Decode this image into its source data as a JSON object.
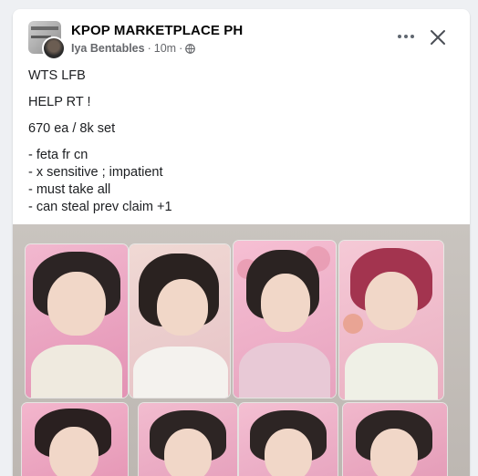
{
  "post": {
    "group_name": "KPOP MARKETPLACE PH",
    "author": "Iya Bentables",
    "separator": "·",
    "time": "10m",
    "separator2": "·",
    "privacy_icon": "globe-icon",
    "actions": {
      "more_icon": "more-horizontal-icon",
      "close_icon": "close-icon"
    },
    "text": {
      "line1": "WTS LFB",
      "line2": "HELP RT !",
      "line3": "670 ea / 8k set",
      "bullets": [
        "- feta fr cn",
        "- x sensitive ; impatient",
        "- must take all",
        "- can steal prev claim +1"
      ]
    }
  },
  "colors": {
    "card_bg": "#ffffff",
    "page_bg": "#eef0f3",
    "text": "#1c1e21",
    "meta": "#65676b",
    "photocard_pink": "#e8a9c3"
  }
}
